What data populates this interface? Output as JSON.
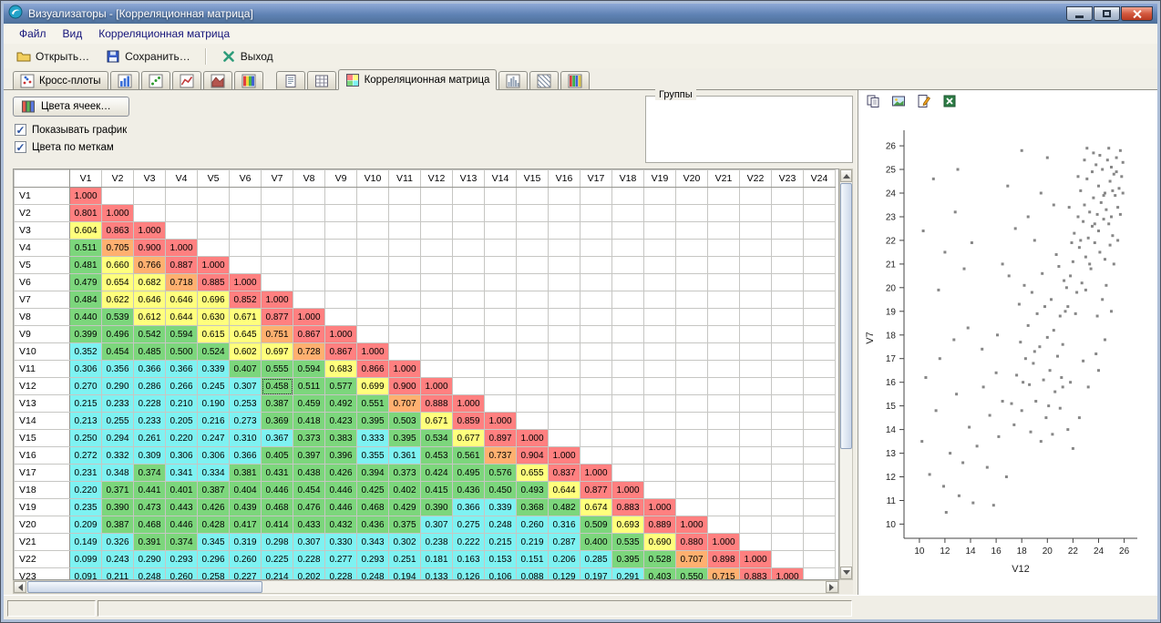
{
  "window": {
    "title": "Визуализаторы - [Корреляционная матрица]"
  },
  "menu": {
    "items": [
      "Файл",
      "Вид",
      "Корреляционная матрица"
    ]
  },
  "toolbar": {
    "open_label": "Открыть…",
    "save_label": "Сохранить…",
    "exit_label": "Выход"
  },
  "tabs": {
    "cross_plots_label": "Кросс-плоты",
    "active_label": "Корреляционная матрица",
    "icon_tabs_left": [
      "bar-chart",
      "scatter",
      "line-chart",
      "area-chart",
      "spectrum"
    ],
    "icon_tabs_mid": [
      "report",
      "grid"
    ],
    "icon_tabs_right": [
      "histogram",
      "hatch",
      "columns"
    ]
  },
  "controls": {
    "cell_colors_label": "Цвета ячеек…",
    "show_graph_label": "Показывать график",
    "show_graph_checked": true,
    "colors_by_labels_label": "Цвета по меткам",
    "colors_by_labels_checked": true,
    "groups_label": "Группы"
  },
  "panel": {
    "icons": [
      "copy",
      "image",
      "edit",
      "excel"
    ]
  },
  "matrix": {
    "columns": [
      "V1",
      "V2",
      "V3",
      "V4",
      "V5",
      "V6",
      "V7",
      "V8",
      "V9",
      "V10",
      "V11",
      "V12",
      "V13",
      "V14",
      "V15",
      "V16",
      "V17",
      "V18",
      "V19",
      "V20",
      "V21",
      "V22",
      "V23",
      "V24"
    ],
    "selected": {
      "row": "V12",
      "col": "V7"
    },
    "colors": {
      "red": "#ff8080",
      "orange": "#ffb070",
      "yellow": "#ffff7d",
      "green": "#7cd67c",
      "cyan": "#7ef2f2"
    },
    "thresholds": {
      "red": 0.8,
      "orange": 0.7,
      "yellow": 0.6,
      "green": 0.3675
    },
    "rows": [
      {
        "label": "V1",
        "values": [
          1.0
        ]
      },
      {
        "label": "V2",
        "values": [
          0.801,
          1.0
        ]
      },
      {
        "label": "V3",
        "values": [
          0.604,
          0.863,
          1.0
        ]
      },
      {
        "label": "V4",
        "values": [
          0.511,
          0.705,
          0.9,
          1.0
        ]
      },
      {
        "label": "V5",
        "values": [
          0.481,
          0.66,
          0.766,
          0.887,
          1.0
        ]
      },
      {
        "label": "V6",
        "values": [
          0.479,
          0.654,
          0.682,
          0.718,
          0.885,
          1.0
        ]
      },
      {
        "label": "V7",
        "values": [
          0.484,
          0.622,
          0.646,
          0.646,
          0.696,
          0.852,
          1.0
        ]
      },
      {
        "label": "V8",
        "values": [
          0.44,
          0.539,
          0.612,
          0.644,
          0.63,
          0.671,
          0.877,
          1.0
        ]
      },
      {
        "label": "V9",
        "values": [
          0.399,
          0.496,
          0.542,
          0.594,
          0.615,
          0.645,
          0.751,
          0.867,
          1.0
        ]
      },
      {
        "label": "V10",
        "values": [
          0.352,
          0.454,
          0.485,
          0.5,
          0.524,
          0.602,
          0.697,
          0.728,
          0.867,
          1.0
        ]
      },
      {
        "label": "V11",
        "values": [
          0.306,
          0.356,
          0.366,
          0.366,
          0.339,
          0.407,
          0.555,
          0.594,
          0.683,
          0.866,
          1.0
        ]
      },
      {
        "label": "V12",
        "values": [
          0.27,
          0.29,
          0.286,
          0.266,
          0.245,
          0.307,
          0.458,
          0.511,
          0.577,
          0.699,
          0.9,
          1.0
        ]
      },
      {
        "label": "V13",
        "values": [
          0.215,
          0.233,
          0.228,
          0.21,
          0.19,
          0.253,
          0.387,
          0.459,
          0.492,
          0.551,
          0.707,
          0.888,
          1.0
        ]
      },
      {
        "label": "V14",
        "values": [
          0.213,
          0.255,
          0.233,
          0.205,
          0.216,
          0.273,
          0.369,
          0.418,
          0.423,
          0.395,
          0.503,
          0.671,
          0.859,
          1.0
        ]
      },
      {
        "label": "V15",
        "values": [
          0.25,
          0.294,
          0.261,
          0.22,
          0.247,
          0.31,
          0.367,
          0.373,
          0.383,
          0.333,
          0.395,
          0.534,
          0.677,
          0.897,
          1.0
        ]
      },
      {
        "label": "V16",
        "values": [
          0.272,
          0.332,
          0.309,
          0.306,
          0.306,
          0.366,
          0.405,
          0.397,
          0.396,
          0.355,
          0.361,
          0.453,
          0.561,
          0.737,
          0.904,
          1.0
        ]
      },
      {
        "label": "V17",
        "values": [
          0.231,
          0.348,
          0.374,
          0.341,
          0.334,
          0.381,
          0.431,
          0.438,
          0.426,
          0.394,
          0.373,
          0.424,
          0.495,
          0.576,
          0.655,
          0.837,
          1.0
        ]
      },
      {
        "label": "V18",
        "values": [
          0.22,
          0.371,
          0.441,
          0.401,
          0.387,
          0.404,
          0.446,
          0.454,
          0.446,
          0.425,
          0.402,
          0.415,
          0.436,
          0.45,
          0.493,
          0.644,
          0.877,
          1.0
        ]
      },
      {
        "label": "V19",
        "values": [
          0.235,
          0.39,
          0.473,
          0.443,
          0.426,
          0.439,
          0.468,
          0.476,
          0.446,
          0.468,
          0.429,
          0.39,
          0.366,
          0.339,
          0.368,
          0.482,
          0.674,
          0.883,
          1.0
        ]
      },
      {
        "label": "V20",
        "values": [
          0.209,
          0.387,
          0.468,
          0.446,
          0.428,
          0.417,
          0.414,
          0.433,
          0.432,
          0.436,
          0.375,
          0.307,
          0.275,
          0.248,
          0.26,
          0.316,
          0.509,
          0.693,
          0.889,
          1.0
        ]
      },
      {
        "label": "V21",
        "values": [
          0.149,
          0.326,
          0.391,
          0.374,
          0.345,
          0.319,
          0.298,
          0.307,
          0.33,
          0.343,
          0.302,
          0.238,
          0.222,
          0.215,
          0.219,
          0.287,
          0.4,
          0.535,
          0.69,
          0.88,
          1.0
        ]
      },
      {
        "label": "V22",
        "values": [
          0.099,
          0.243,
          0.29,
          0.293,
          0.296,
          0.26,
          0.225,
          0.228,
          0.277,
          0.293,
          0.251,
          0.181,
          0.163,
          0.153,
          0.151,
          0.206,
          0.285,
          0.395,
          0.528,
          0.707,
          0.898,
          1.0
        ]
      },
      {
        "label": "V23",
        "values": [
          0.091,
          0.211,
          0.248,
          0.26,
          0.258,
          0.227,
          0.214,
          0.202,
          0.228,
          0.248,
          0.194,
          0.133,
          0.126,
          0.106,
          0.088,
          0.129,
          0.197,
          0.291,
          0.403,
          0.55,
          0.715,
          0.883,
          1.0
        ]
      }
    ]
  },
  "chart_data": {
    "type": "scatter",
    "xlabel": "V12",
    "ylabel": "V7",
    "x_ticks": [
      10,
      12,
      14,
      16,
      18,
      20,
      22,
      24,
      26
    ],
    "y_ticks": [
      10,
      11,
      12,
      13,
      14,
      15,
      16,
      17,
      18,
      19,
      20,
      21,
      22,
      23,
      24,
      25,
      26
    ],
    "x_range": [
      8.8,
      27.0
    ],
    "y_range": [
      9.4,
      26.4
    ],
    "point_color": "#878787",
    "points": [
      [
        21.6,
        19.2
      ],
      [
        21.8,
        20.5
      ],
      [
        22,
        21.1
      ],
      [
        22.1,
        22.3
      ],
      [
        22.3,
        19.8
      ],
      [
        22.4,
        23
      ],
      [
        22.5,
        21.7
      ],
      [
        22.6,
        24.1
      ],
      [
        22.7,
        20.2
      ],
      [
        22.8,
        22.8
      ],
      [
        22.9,
        23.5
      ],
      [
        23,
        21.3
      ],
      [
        23.1,
        24.6
      ],
      [
        23.2,
        22.1
      ],
      [
        23.3,
        23.2
      ],
      [
        23.4,
        20.8
      ],
      [
        23.5,
        24.9
      ],
      [
        23.5,
        22.6
      ],
      [
        23.6,
        23.8
      ],
      [
        23.7,
        21.9
      ],
      [
        23.8,
        25.2
      ],
      [
        23.9,
        23.1
      ],
      [
        24,
        22.4
      ],
      [
        24,
        24.3
      ],
      [
        24.1,
        21.5
      ],
      [
        24.2,
        23.6
      ],
      [
        24.3,
        25
      ],
      [
        24.4,
        22.9
      ],
      [
        24.5,
        24
      ],
      [
        24.5,
        21.2
      ],
      [
        24.6,
        23.3
      ],
      [
        24.7,
        25.4
      ],
      [
        24.8,
        22.7
      ],
      [
        24.9,
        24.5
      ],
      [
        25,
        23
      ],
      [
        25,
        25.1
      ],
      [
        25.1,
        22.2
      ],
      [
        25.2,
        24.8
      ],
      [
        25.3,
        23.9
      ],
      [
        25.4,
        25.5
      ],
      [
        25.5,
        23.4
      ],
      [
        25.6,
        24.2
      ],
      [
        25.7,
        25.8
      ],
      [
        25.8,
        24.7
      ],
      [
        25.9,
        25.3
      ],
      [
        24.3,
        19.5
      ],
      [
        23.9,
        18.8
      ],
      [
        24.6,
        20.1
      ],
      [
        25.2,
        21
      ],
      [
        22.2,
        18.9
      ],
      [
        23,
        19.9
      ],
      [
        25.5,
        22
      ],
      [
        24.8,
        25.9
      ],
      [
        23.6,
        25.7
      ],
      [
        22.9,
        25.4
      ],
      [
        24.1,
        25.6
      ],
      [
        25.7,
        23.1
      ],
      [
        21.9,
        21.9
      ],
      [
        22.6,
        22
      ],
      [
        23.3,
        21
      ],
      [
        24.4,
        23.9
      ],
      [
        25.1,
        24.1
      ],
      [
        21.7,
        23.4
      ],
      [
        22.4,
        24.7
      ],
      [
        23.1,
        25.9
      ],
      [
        25.9,
        24
      ],
      [
        21.5,
        20
      ],
      [
        23.7,
        22.7
      ],
      [
        24.9,
        21.8
      ],
      [
        25.4,
        24.9
      ],
      [
        17.2,
        15.1
      ],
      [
        17.6,
        16.3
      ],
      [
        18,
        14.8
      ],
      [
        18.3,
        17
      ],
      [
        18.6,
        15.9
      ],
      [
        18.9,
        16.8
      ],
      [
        19.1,
        15.2
      ],
      [
        19.4,
        17.5
      ],
      [
        19.7,
        16.1
      ],
      [
        20,
        17.9
      ],
      [
        20.2,
        16.5
      ],
      [
        20.5,
        18.2
      ],
      [
        20.8,
        17.1
      ],
      [
        21,
        18.8
      ],
      [
        21.2,
        17.6
      ],
      [
        21.4,
        19
      ],
      [
        19.9,
        14.5
      ],
      [
        20.6,
        15.6
      ],
      [
        21.1,
        16.2
      ],
      [
        18.5,
        18.4
      ],
      [
        19.2,
        18.9
      ],
      [
        20.3,
        19.5
      ],
      [
        21.3,
        20.3
      ],
      [
        17.9,
        17.7
      ],
      [
        18.8,
        19.8
      ],
      [
        19.6,
        20.6
      ],
      [
        20.9,
        20.9
      ],
      [
        17.4,
        14.2
      ],
      [
        18.1,
        16
      ],
      [
        19,
        17.3
      ],
      [
        20.1,
        15
      ],
      [
        21,
        14.9
      ],
      [
        20.4,
        13.8
      ],
      [
        19.5,
        13.5
      ],
      [
        18.7,
        13.9
      ],
      [
        21.2,
        15.8
      ],
      [
        17.8,
        19.3
      ],
      [
        18.2,
        20.1
      ],
      [
        19.8,
        19.2
      ],
      [
        20.7,
        21.4
      ],
      [
        10.2,
        13.5
      ],
      [
        10.8,
        12.1
      ],
      [
        11.3,
        14.8
      ],
      [
        11.9,
        11.6
      ],
      [
        12.4,
        13
      ],
      [
        12.9,
        15.5
      ],
      [
        13.4,
        12.6
      ],
      [
        13.9,
        14.1
      ],
      [
        14.5,
        13.3
      ],
      [
        15,
        15.8
      ],
      [
        15.5,
        14.6
      ],
      [
        16,
        16.4
      ],
      [
        16.5,
        15.2
      ],
      [
        12.1,
        10.5
      ],
      [
        13.1,
        11.2
      ],
      [
        14.2,
        10.9
      ],
      [
        15.3,
        12.4
      ],
      [
        16.2,
        13.7
      ],
      [
        10.5,
        16.2
      ],
      [
        11.6,
        17
      ],
      [
        12.7,
        17.8
      ],
      [
        13.8,
        18.3
      ],
      [
        14.9,
        17.4
      ],
      [
        16.1,
        18
      ],
      [
        15.8,
        10.8
      ],
      [
        16.8,
        12
      ],
      [
        10.3,
        22.4
      ],
      [
        11.1,
        24.6
      ],
      [
        12,
        21.5
      ],
      [
        12.8,
        23.2
      ],
      [
        13.5,
        20.8
      ],
      [
        11.5,
        19.9
      ],
      [
        13,
        25
      ],
      [
        14.1,
        21.9
      ],
      [
        22.5,
        14.5
      ],
      [
        23.2,
        15.8
      ],
      [
        24,
        16.5
      ],
      [
        22,
        13.2
      ],
      [
        25,
        19
      ],
      [
        24.5,
        17.8
      ],
      [
        23.8,
        17.2
      ],
      [
        22.8,
        16.9
      ],
      [
        21.8,
        16
      ],
      [
        21.6,
        14
      ],
      [
        16.5,
        21
      ],
      [
        17.5,
        22.5
      ],
      [
        18.5,
        23
      ],
      [
        19.5,
        24
      ],
      [
        20.5,
        23.5
      ],
      [
        17,
        20.5
      ],
      [
        19,
        22
      ],
      [
        20,
        25.5
      ],
      [
        18,
        25.8
      ],
      [
        16.9,
        24.3
      ]
    ]
  }
}
